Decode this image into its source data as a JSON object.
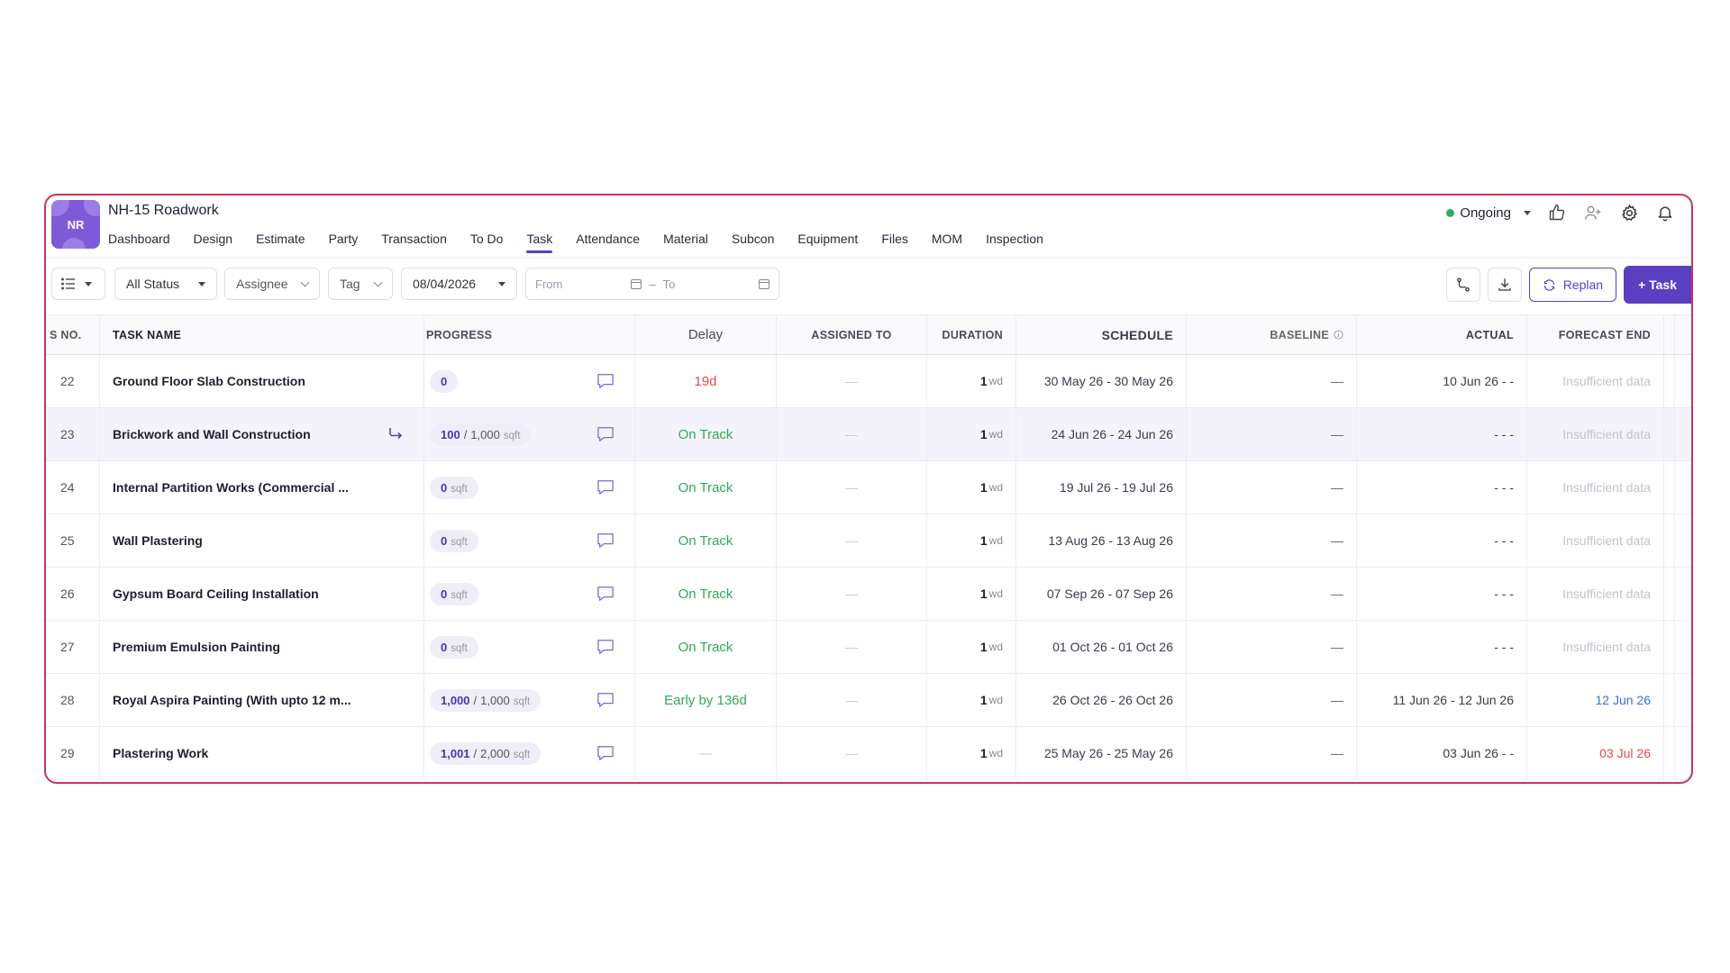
{
  "project": {
    "initials": "NR",
    "title": "NH-15 Roadwork"
  },
  "nav": [
    "Dashboard",
    "Design",
    "Estimate",
    "Party",
    "Transaction",
    "To Do",
    "Task",
    "Attendance",
    "Material",
    "Subcon",
    "Equipment",
    "Files",
    "MOM",
    "Inspection"
  ],
  "active_tab": "Task",
  "status": {
    "label": "Ongoing",
    "color": "#2fae60"
  },
  "filters": {
    "status": "All Status",
    "assignee": "Assignee",
    "tag": "Tag",
    "date": "08/04/2026",
    "from_placeholder": "From",
    "to_placeholder": "To"
  },
  "buttons": {
    "replan": "Replan",
    "add_task": "+ Task"
  },
  "columns": {
    "sno": "S NO.",
    "name": "TASK NAME",
    "progress": "PROGRESS",
    "delay": "Delay",
    "assigned": "ASSIGNED TO",
    "duration": "DURATION",
    "schedule": "SCHEDULE",
    "baseline": "BASELINE",
    "actual": "ACTUAL",
    "forecast": "FORECAST END"
  },
  "rows": [
    {
      "sno": "22",
      "name": "Ground Floor Slab Construction",
      "prog_done": "0",
      "prog_sep": "",
      "prog_total": "",
      "prog_unit": "",
      "delay": "19d",
      "assigned": "—",
      "dur_num": "1",
      "dur_unit": "wd",
      "schedule": "30 May 26 - 30 May 26",
      "baseline": "—",
      "actual": "10 Jun 26 - -",
      "forecast": "Insufficient data"
    },
    {
      "sno": "23",
      "name": "Brickwork and Wall Construction",
      "prog_done": "100",
      "prog_sep": "/",
      "prog_total": "1,000",
      "prog_unit": "sqft",
      "delay": "On Track",
      "assigned": "—",
      "dur_num": "1",
      "dur_unit": "wd",
      "schedule": "24 Jun 26 - 24 Jun 26",
      "baseline": "—",
      "actual": "- - -",
      "forecast": "Insufficient data"
    },
    {
      "sno": "24",
      "name": "Internal Partition Works (Commercial ...",
      "prog_done": "0",
      "prog_sep": "",
      "prog_total": "",
      "prog_unit": "sqft",
      "delay": "On Track",
      "assigned": "—",
      "dur_num": "1",
      "dur_unit": "wd",
      "schedule": "19 Jul 26 - 19 Jul 26",
      "baseline": "—",
      "actual": "- - -",
      "forecast": "Insufficient data"
    },
    {
      "sno": "25",
      "name": "Wall Plastering",
      "prog_done": "0",
      "prog_sep": "",
      "prog_total": "",
      "prog_unit": "sqft",
      "delay": "On Track",
      "assigned": "—",
      "dur_num": "1",
      "dur_unit": "wd",
      "schedule": "13 Aug 26 - 13 Aug 26",
      "baseline": "—",
      "actual": "- - -",
      "forecast": "Insufficient data"
    },
    {
      "sno": "26",
      "name": "Gypsum Board Ceiling Installation",
      "prog_done": "0",
      "prog_sep": "",
      "prog_total": "",
      "prog_unit": "sqft",
      "delay": "On Track",
      "assigned": "—",
      "dur_num": "1",
      "dur_unit": "wd",
      "schedule": "07 Sep 26 - 07 Sep 26",
      "baseline": "—",
      "actual": "- - -",
      "forecast": "Insufficient data"
    },
    {
      "sno": "27",
      "name": "Premium Emulsion Painting",
      "prog_done": "0",
      "prog_sep": "",
      "prog_total": "",
      "prog_unit": "sqft",
      "delay": "On Track",
      "assigned": "—",
      "dur_num": "1",
      "dur_unit": "wd",
      "schedule": "01 Oct 26 - 01 Oct 26",
      "baseline": "—",
      "actual": "- - -",
      "forecast": "Insufficient data"
    },
    {
      "sno": "28",
      "name": "Royal Aspira Painting (With upto 12 m...",
      "prog_done": "1,000",
      "prog_sep": "/",
      "prog_total": "1,000",
      "prog_unit": "sqft",
      "delay": "Early by 136d",
      "assigned": "—",
      "dur_num": "1",
      "dur_unit": "wd",
      "schedule": "26 Oct 26 - 26 Oct 26",
      "baseline": "—",
      "actual": "11 Jun 26 - 12 Jun 26",
      "forecast": "12 Jun 26"
    },
    {
      "sno": "29",
      "name": "Plastering Work",
      "prog_done": "1,001",
      "prog_sep": "/",
      "prog_total": "2,000",
      "prog_unit": "sqft",
      "delay": "—",
      "assigned": "—",
      "dur_num": "1",
      "dur_unit": "wd",
      "schedule": "25 May 26 - 25 May 26",
      "baseline": "—",
      "actual": "03 Jun 26 - -",
      "forecast": "03 Jul 26"
    }
  ],
  "row_styles": {
    "highlight_row": "23",
    "delay_colors": {
      "red": "#e04a4a",
      "green": "#2faa55"
    },
    "forecast_colors": {
      "blue": "#3a6fdc",
      "red": "#e04a4a"
    }
  },
  "icons": [
    "list-view-icon",
    "calendar-icon",
    "thumbs-up-icon",
    "add-user-icon",
    "gear-icon",
    "bell-icon",
    "dependency-icon",
    "download-icon",
    "refresh-icon",
    "comment-icon",
    "subtask-arrow-icon",
    "info-icon"
  ]
}
